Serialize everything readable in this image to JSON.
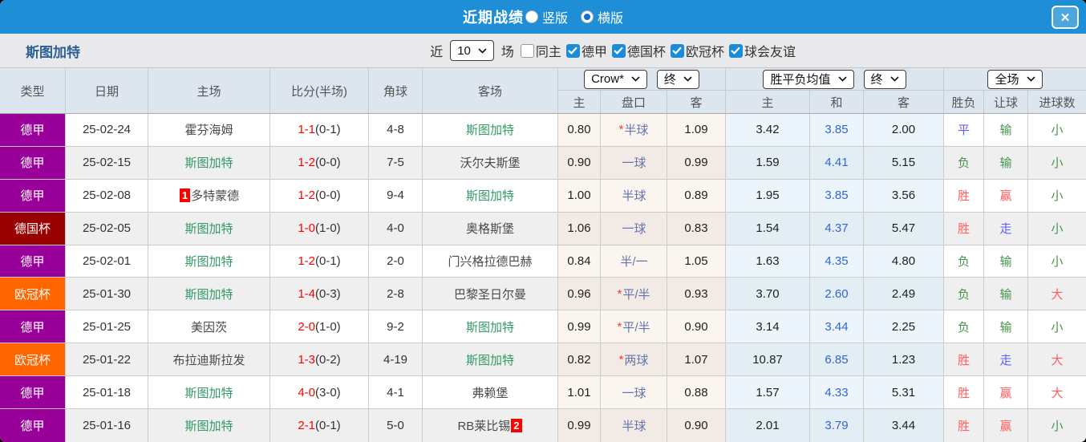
{
  "modal": {
    "title": "近期战绩",
    "close_label": "✕",
    "view_options": [
      {
        "label": "竖版",
        "selected": false
      },
      {
        "label": "横版",
        "selected": true
      }
    ]
  },
  "filters": {
    "team": "斯图加特",
    "recent_label": "近",
    "recent_value": "10",
    "games_label": "场",
    "same_home_label": "同主",
    "same_home_checked": false,
    "leagues": [
      {
        "label": "德甲",
        "checked": true
      },
      {
        "label": "德国杯",
        "checked": true
      },
      {
        "label": "欧冠杯",
        "checked": true
      },
      {
        "label": "球会友谊",
        "checked": true
      }
    ]
  },
  "table": {
    "columns": [
      "类型",
      "日期",
      "主场",
      "比分(半场)",
      "角球",
      "客场"
    ],
    "odds_groups": [
      {
        "selects": [
          "Crow*",
          "终"
        ],
        "sub": [
          "主",
          "盘口",
          "客"
        ]
      },
      {
        "selects": [
          "胜平负均值",
          "终"
        ],
        "sub": [
          "主",
          "和",
          "客"
        ]
      },
      {
        "selects": [
          "全场"
        ],
        "sub": [
          "胜负",
          "让球",
          "进球数"
        ]
      }
    ]
  },
  "colors": {
    "accent_blue": "#1e8fd6",
    "score_red": "#ff0000",
    "self_team_green": "#339966",
    "handicap_line_blue": "#6673ad",
    "avg_draw_blue": "#3366cc"
  },
  "league_colors": {
    "德甲": "#990099",
    "德国杯": "#990000",
    "欧冠杯": "#ff6600"
  },
  "result_colors": {
    "red": "#ff5e5e",
    "blue": "#5f5fff",
    "green": "#46944a"
  },
  "rows": [
    {
      "league": "德甲",
      "date": "25-02-24",
      "home": {
        "name": "霍芬海姆"
      },
      "score": "1-1",
      "half": "(0-1)",
      "corners": "4-8",
      "away": {
        "name": "斯图加特",
        "self": true
      },
      "ah": {
        "home": "0.80",
        "star": true,
        "line": "半球",
        "away": "1.09"
      },
      "avg": {
        "home": "3.42",
        "draw": "3.85",
        "away": "2.00"
      },
      "res": {
        "wdl": {
          "t": "平",
          "c": "blue"
        },
        "rq": {
          "t": "输",
          "c": "green"
        },
        "jq": {
          "t": "小",
          "c": "green"
        }
      }
    },
    {
      "league": "德甲",
      "date": "25-02-15",
      "home": {
        "name": "斯图加特",
        "self": true
      },
      "score": "1-2",
      "half": "(0-0)",
      "corners": "7-5",
      "away": {
        "name": "沃尔夫斯堡"
      },
      "ah": {
        "home": "0.90",
        "star": false,
        "line": "一球",
        "away": "0.99"
      },
      "avg": {
        "home": "1.59",
        "draw": "4.41",
        "away": "5.15"
      },
      "res": {
        "wdl": {
          "t": "负",
          "c": "green"
        },
        "rq": {
          "t": "输",
          "c": "green"
        },
        "jq": {
          "t": "小",
          "c": "green"
        }
      }
    },
    {
      "league": "德甲",
      "date": "25-02-08",
      "home": {
        "name": "多特蒙德",
        "badge": {
          "text": "1",
          "pos": "before"
        }
      },
      "score": "1-2",
      "half": "(0-0)",
      "corners": "9-4",
      "away": {
        "name": "斯图加特",
        "self": true
      },
      "ah": {
        "home": "1.00",
        "star": false,
        "line": "半球",
        "away": "0.89"
      },
      "avg": {
        "home": "1.95",
        "draw": "3.85",
        "away": "3.56"
      },
      "res": {
        "wdl": {
          "t": "胜",
          "c": "red"
        },
        "rq": {
          "t": "赢",
          "c": "red"
        },
        "jq": {
          "t": "小",
          "c": "green"
        }
      }
    },
    {
      "league": "德国杯",
      "date": "25-02-05",
      "home": {
        "name": "斯图加特",
        "self": true
      },
      "score": "1-0",
      "half": "(1-0)",
      "corners": "4-0",
      "away": {
        "name": "奥格斯堡"
      },
      "ah": {
        "home": "1.06",
        "star": false,
        "line": "一球",
        "away": "0.83"
      },
      "avg": {
        "home": "1.54",
        "draw": "4.37",
        "away": "5.47"
      },
      "res": {
        "wdl": {
          "t": "胜",
          "c": "red"
        },
        "rq": {
          "t": "走",
          "c": "blue"
        },
        "jq": {
          "t": "小",
          "c": "green"
        }
      }
    },
    {
      "league": "德甲",
      "date": "25-02-01",
      "home": {
        "name": "斯图加特",
        "self": true
      },
      "score": "1-2",
      "half": "(0-1)",
      "corners": "2-0",
      "away": {
        "name": "门兴格拉德巴赫"
      },
      "ah": {
        "home": "0.84",
        "star": false,
        "line": "半/一",
        "away": "1.05"
      },
      "avg": {
        "home": "1.63",
        "draw": "4.35",
        "away": "4.80"
      },
      "res": {
        "wdl": {
          "t": "负",
          "c": "green"
        },
        "rq": {
          "t": "输",
          "c": "green"
        },
        "jq": {
          "t": "小",
          "c": "green"
        }
      }
    },
    {
      "league": "欧冠杯",
      "date": "25-01-30",
      "home": {
        "name": "斯图加特",
        "self": true
      },
      "score": "1-4",
      "half": "(0-3)",
      "corners": "2-8",
      "away": {
        "name": "巴黎圣日尔曼"
      },
      "ah": {
        "home": "0.96",
        "star": true,
        "line": "平/半",
        "away": "0.93"
      },
      "avg": {
        "home": "3.70",
        "draw": "2.60",
        "away": "2.49"
      },
      "res": {
        "wdl": {
          "t": "负",
          "c": "green"
        },
        "rq": {
          "t": "输",
          "c": "green"
        },
        "jq": {
          "t": "大",
          "c": "red"
        }
      }
    },
    {
      "league": "德甲",
      "date": "25-01-25",
      "home": {
        "name": "美因茨"
      },
      "score": "2-0",
      "half": "(1-0)",
      "corners": "9-2",
      "away": {
        "name": "斯图加特",
        "self": true
      },
      "ah": {
        "home": "0.99",
        "star": true,
        "line": "平/半",
        "away": "0.90"
      },
      "avg": {
        "home": "3.14",
        "draw": "3.44",
        "away": "2.25"
      },
      "res": {
        "wdl": {
          "t": "负",
          "c": "green"
        },
        "rq": {
          "t": "输",
          "c": "green"
        },
        "jq": {
          "t": "小",
          "c": "green"
        }
      }
    },
    {
      "league": "欧冠杯",
      "date": "25-01-22",
      "home": {
        "name": "布拉迪斯拉发"
      },
      "score": "1-3",
      "half": "(0-2)",
      "corners": "4-19",
      "away": {
        "name": "斯图加特",
        "self": true
      },
      "ah": {
        "home": "0.82",
        "star": true,
        "line": "两球",
        "away": "1.07"
      },
      "avg": {
        "home": "10.87",
        "draw": "6.85",
        "away": "1.23"
      },
      "res": {
        "wdl": {
          "t": "胜",
          "c": "red"
        },
        "rq": {
          "t": "走",
          "c": "blue"
        },
        "jq": {
          "t": "大",
          "c": "red"
        }
      }
    },
    {
      "league": "德甲",
      "date": "25-01-18",
      "home": {
        "name": "斯图加特",
        "self": true
      },
      "score": "4-0",
      "half": "(3-0)",
      "corners": "4-1",
      "away": {
        "name": "弗赖堡"
      },
      "ah": {
        "home": "1.01",
        "star": false,
        "line": "一球",
        "away": "0.88"
      },
      "avg": {
        "home": "1.57",
        "draw": "4.33",
        "away": "5.31"
      },
      "res": {
        "wdl": {
          "t": "胜",
          "c": "red"
        },
        "rq": {
          "t": "赢",
          "c": "red"
        },
        "jq": {
          "t": "大",
          "c": "red"
        }
      }
    },
    {
      "league": "德甲",
      "date": "25-01-16",
      "home": {
        "name": "斯图加特",
        "self": true
      },
      "score": "2-1",
      "half": "(0-1)",
      "corners": "5-0",
      "away": {
        "name": "RB莱比锡",
        "badge": {
          "text": "2",
          "pos": "after"
        }
      },
      "ah": {
        "home": "0.99",
        "star": false,
        "line": "半球",
        "away": "0.90"
      },
      "avg": {
        "home": "2.01",
        "draw": "3.79",
        "away": "3.44"
      },
      "res": {
        "wdl": {
          "t": "胜",
          "c": "red"
        },
        "rq": {
          "t": "赢",
          "c": "red"
        },
        "jq": {
          "t": "小",
          "c": "green"
        }
      }
    }
  ]
}
